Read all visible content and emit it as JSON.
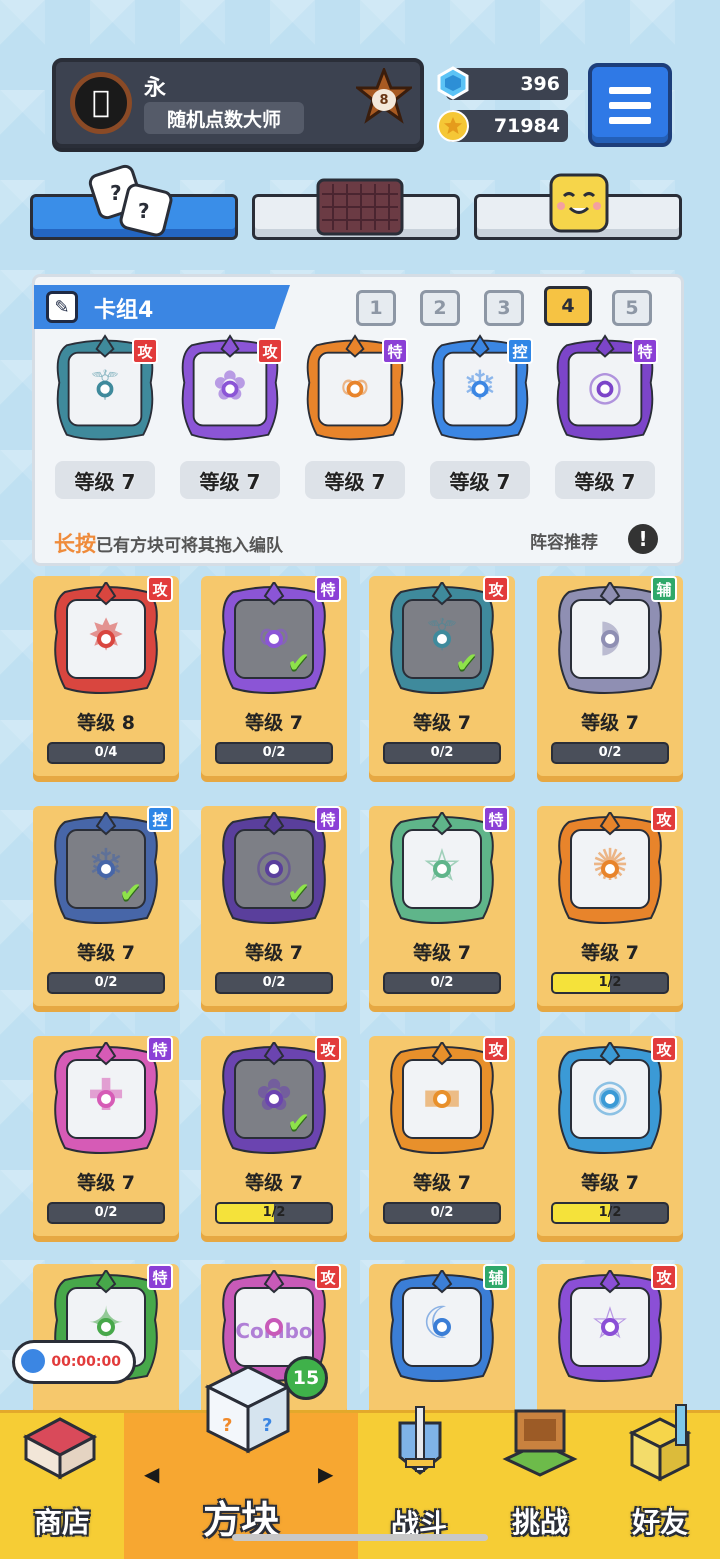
{
  "profile": {
    "name": "永",
    "title": "随机点数大师",
    "rank": "8"
  },
  "currencies": {
    "gems": "396",
    "coins": "71984"
  },
  "deck": {
    "label": "卡组4",
    "numbers": [
      "1",
      "2",
      "3",
      "4",
      "5"
    ],
    "active_number": "4",
    "slots": [
      {
        "type": "攻",
        "level": "等级 7"
      },
      {
        "type": "攻",
        "level": "等级 7"
      },
      {
        "type": "特",
        "level": "等级 7"
      },
      {
        "type": "控",
        "level": "等级 7"
      },
      {
        "type": "特",
        "level": "等级 7"
      }
    ],
    "hint_highlight": "长按",
    "hint_rest": "已有方块可将其拖入编队",
    "recommend": "阵容推荐",
    "recommend_icon": "!"
  },
  "cards": [
    {
      "type": "攻",
      "level": "等级 8",
      "progress": "0/4",
      "fill": 0,
      "checked": false
    },
    {
      "type": "特",
      "level": "等级 7",
      "progress": "0/2",
      "fill": 0,
      "checked": true
    },
    {
      "type": "攻",
      "level": "等级 7",
      "progress": "0/2",
      "fill": 0,
      "checked": true
    },
    {
      "type": "辅",
      "level": "等级 7",
      "progress": "0/2",
      "fill": 0,
      "checked": false
    },
    {
      "type": "控",
      "level": "等级 7",
      "progress": "0/2",
      "fill": 0,
      "checked": true
    },
    {
      "type": "特",
      "level": "等级 7",
      "progress": "0/2",
      "fill": 0,
      "checked": true
    },
    {
      "type": "特",
      "level": "等级 7",
      "progress": "0/2",
      "fill": 0,
      "checked": false
    },
    {
      "type": "攻",
      "level": "等级 7",
      "progress": "1/2",
      "fill": 0.5,
      "checked": false
    },
    {
      "type": "特",
      "level": "等级 7",
      "progress": "0/2",
      "fill": 0,
      "checked": false
    },
    {
      "type": "攻",
      "level": "等级 7",
      "progress": "1/2",
      "fill": 0.5,
      "checked": true
    },
    {
      "type": "攻",
      "level": "等级 7",
      "progress": "0/2",
      "fill": 0,
      "checked": false
    },
    {
      "type": "攻",
      "level": "等级 7",
      "progress": "1/2",
      "fill": 0.5,
      "checked": false
    },
    {
      "type": "特",
      "level": "",
      "progress": "",
      "fill": 0,
      "checked": false
    },
    {
      "type": "攻",
      "level": "",
      "progress": "",
      "fill": 0,
      "checked": false,
      "text": "Combo"
    },
    {
      "type": "辅",
      "level": "",
      "progress": "",
      "fill": 0,
      "checked": false
    },
    {
      "type": "攻",
      "level": "",
      "progress": "",
      "fill": 0,
      "checked": false
    }
  ],
  "timer": "00:00:00",
  "nav": {
    "shop": "商店",
    "blocks": "方块",
    "battle": "战斗",
    "challenge": "挑战",
    "friends": "好友",
    "blocks_badge": "15",
    "arrow_left": "◀",
    "arrow_right": "▶"
  },
  "colors": {
    "attack": "#e23b3b",
    "special": "#8b3fd6",
    "control": "#2f86e6",
    "support": "#2fa86a",
    "accent_blue": "#3b86e3"
  }
}
